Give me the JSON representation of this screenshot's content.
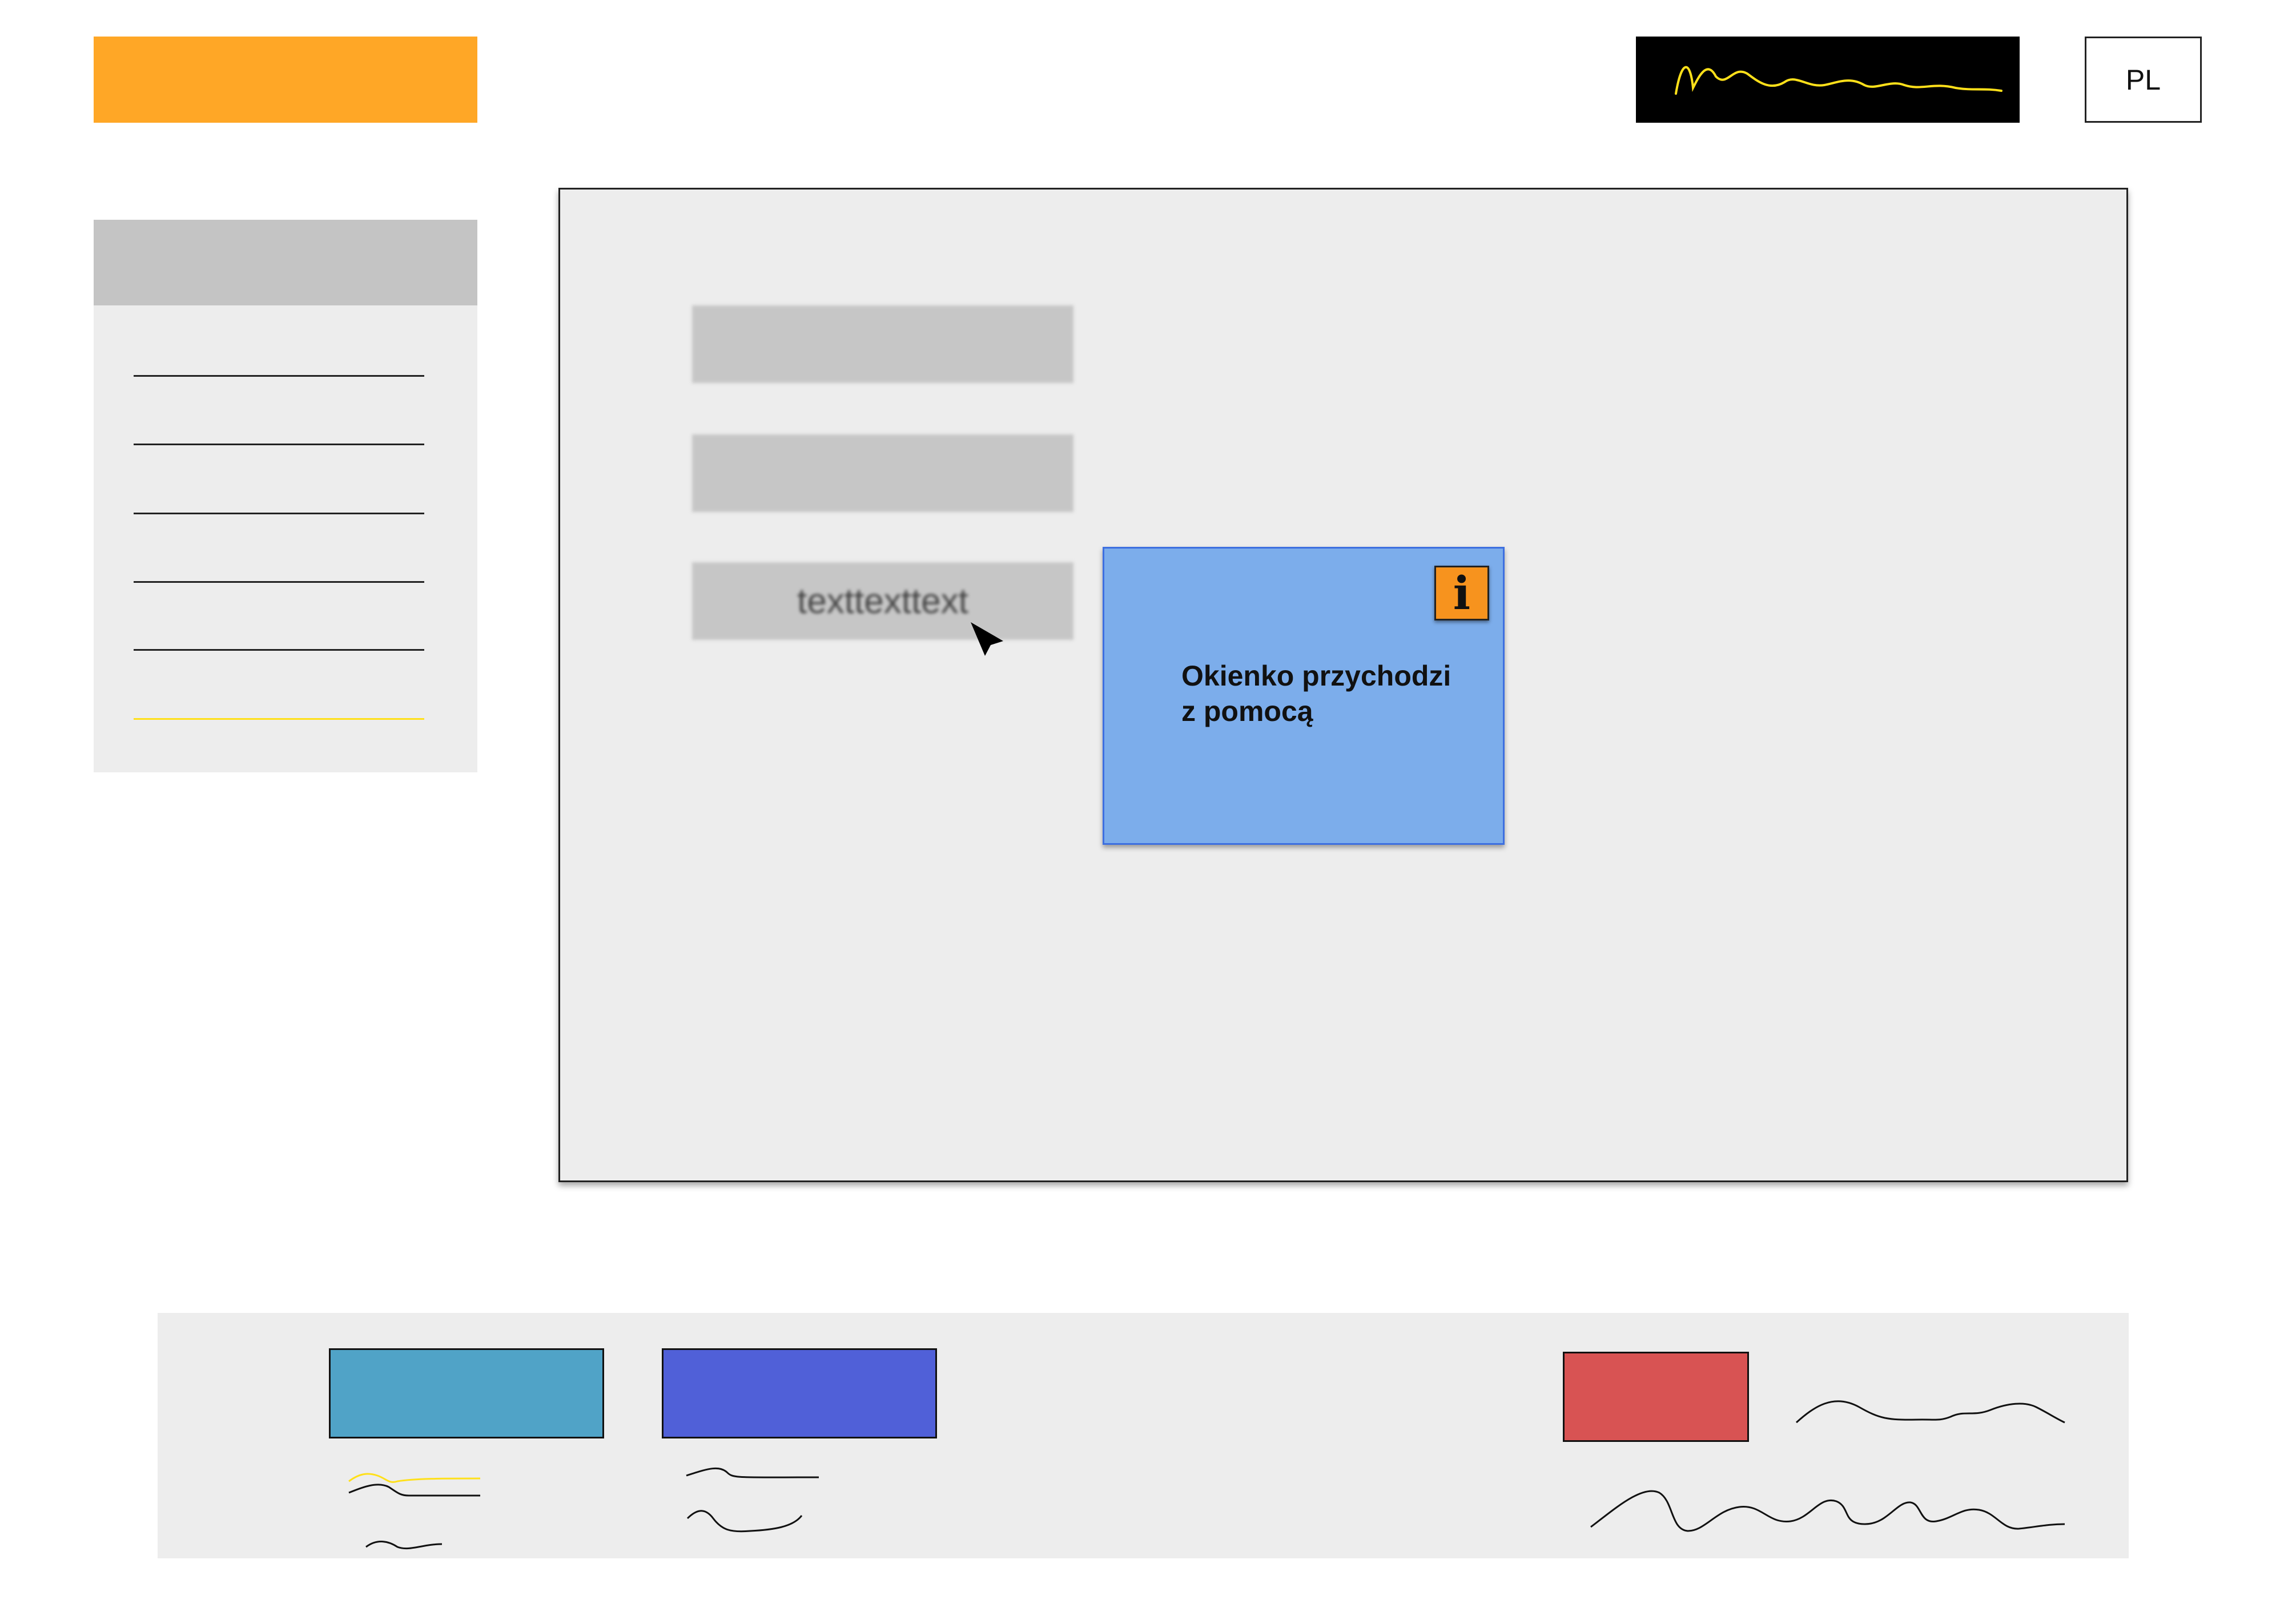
{
  "header": {
    "language_label": "PL"
  },
  "sidebar": {
    "item_count": 6,
    "active_index": 5
  },
  "main": {
    "fields": [
      "",
      "",
      "texttexttext"
    ]
  },
  "tooltip": {
    "icon": "info-icon",
    "text": "Okienko przychodzi\nz pomocą"
  },
  "colors": {
    "brand": "#FFA726",
    "tooltip_bg": "#7CADEB",
    "tooltip_border": "#3D6FE0",
    "info_icon": "#F7931E",
    "accent_line": "#FFE01A",
    "button_teal": "#50A3C7",
    "button_blue": "#5060D8",
    "button_red": "#D85353"
  }
}
